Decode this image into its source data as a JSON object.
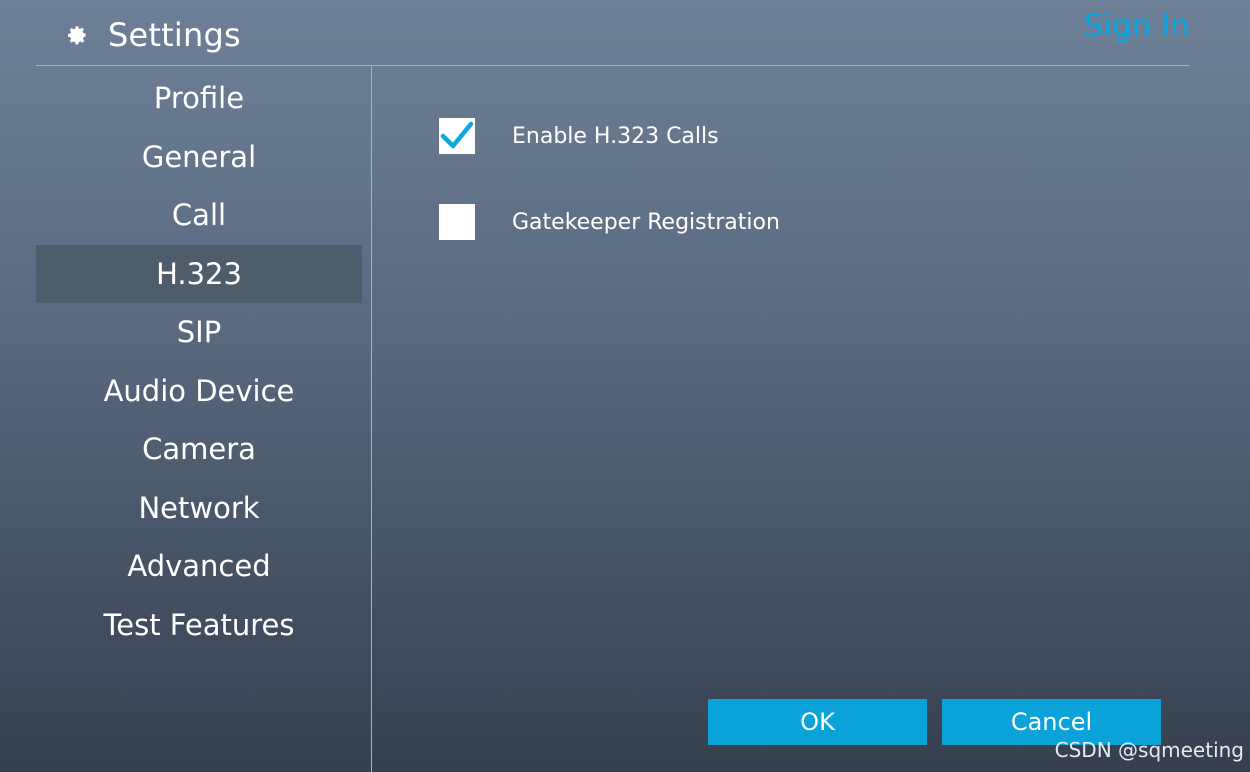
{
  "header": {
    "title": "Settings",
    "sign_in": "Sign In"
  },
  "sidebar": {
    "items": [
      {
        "label": "Profile"
      },
      {
        "label": "General"
      },
      {
        "label": "Call"
      },
      {
        "label": "H.323",
        "active": true
      },
      {
        "label": "SIP"
      },
      {
        "label": "Audio Device"
      },
      {
        "label": "Camera"
      },
      {
        "label": "Network"
      },
      {
        "label": "Advanced"
      },
      {
        "label": "Test Features"
      }
    ]
  },
  "main": {
    "options": [
      {
        "label": "Enable H.323 Calls",
        "checked": true
      },
      {
        "label": "Gatekeeper Registration",
        "checked": false
      }
    ]
  },
  "buttons": {
    "ok": "OK",
    "cancel": "Cancel"
  },
  "watermark": "CSDN @sqmeeting",
  "icons": {
    "settings": "gear-icon",
    "checked": "checkmark-icon"
  },
  "colors": {
    "accent": "#0aa3d9",
    "sign_in": "#0aa6df",
    "active_nav": "#4f5c6c",
    "checkmark": "#10a7e0"
  }
}
